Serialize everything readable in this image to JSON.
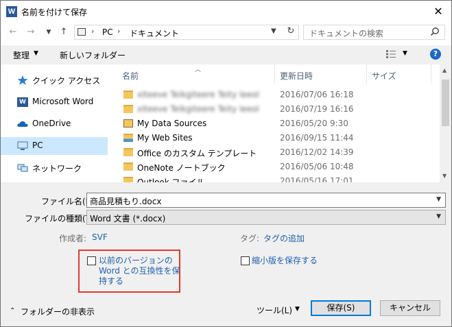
{
  "window": {
    "title": "名前を付けて保存",
    "app_icon": "word-icon",
    "close": "✕"
  },
  "address": {
    "sep": "›",
    "crumbs": [
      "PC",
      "ドキュメント"
    ]
  },
  "search": {
    "placeholder": "ドキュメントの検索"
  },
  "toolbar": {
    "organize": "整理",
    "new_folder": "新しいフォルダー",
    "help": "?"
  },
  "nav": {
    "items": [
      {
        "label": "クイック アクセス",
        "icon": "star-icon"
      },
      {
        "label": "Microsoft Word",
        "icon": "word-icon"
      },
      {
        "label": "OneDrive",
        "icon": "cloud-icon"
      },
      {
        "label": "PC",
        "icon": "computer-icon",
        "selected": true
      },
      {
        "label": "ネットワーク",
        "icon": "network-icon"
      }
    ]
  },
  "filelist": {
    "columns": {
      "name": "名前",
      "date": "更新日時",
      "type": "サイズ"
    },
    "rows": [
      {
        "name": "xiteeve Teikgiteere Teity leeol",
        "date": "2016/07/06 16:18",
        "blurred": true
      },
      {
        "name": "xiteeve Teikgiteere Teity leeol",
        "date": "2016/07/19 16:16",
        "blurred": true
      },
      {
        "name": "My Data Sources",
        "date": "2016/05/20 9:30"
      },
      {
        "name": "My Web Sites",
        "date": "2016/09/15 11:44"
      },
      {
        "name": "Office のカスタム テンプレート",
        "date": "2016/12/02 14:39"
      },
      {
        "name": "OneNote ノートブック",
        "date": "2016/05/06 10:48"
      },
      {
        "name": "Outlook ファイル",
        "date": "2016/05/16 17:01"
      }
    ]
  },
  "form": {
    "filename_label": "ファイル名(N):",
    "filename_value": "商品見積もり.docx",
    "filetype_label": "ファイルの種類(T):",
    "filetype_value": "Word 文書 (*.docx)",
    "author_label": "作成者:",
    "author_value": "SVF",
    "tags_label": "タグ:",
    "tags_value": "タグの追加",
    "compat_lines": [
      "以前のバージョンの",
      "Word との互換性を保",
      "持する"
    ],
    "compat_checked": false,
    "thumbnail_label": "縮小版を保存する",
    "thumbnail_checked": false
  },
  "footer": {
    "hide_folders": "フォルダーの非表示",
    "tools": "ツール(L)",
    "save": "保存(S)",
    "cancel": "キャンセル"
  },
  "colors": {
    "accent": "#0078d7",
    "highlight_box": "#e0382e",
    "selected_nav": "#cce8ff"
  }
}
